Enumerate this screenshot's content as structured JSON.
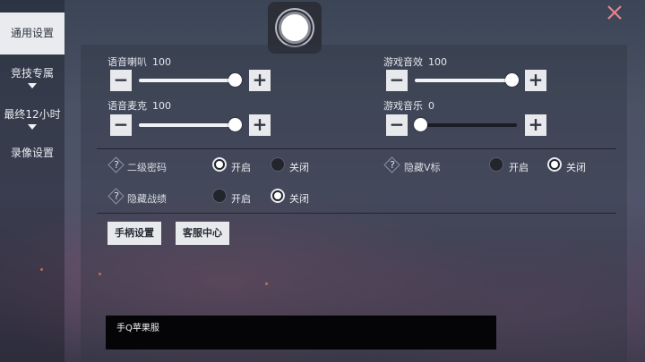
{
  "sidebar": {
    "items": [
      {
        "label": "通用设置",
        "active": true
      },
      {
        "label": "竞技专属",
        "has_caret": true
      },
      {
        "label": "最终12小时",
        "has_caret": true
      },
      {
        "label": "录像设置"
      }
    ]
  },
  "header": {
    "language_icon": "circle-button-icon",
    "close_icon": "close-icon"
  },
  "sliders": [
    {
      "label": "语音喇叭",
      "value": "100",
      "fraction": 1.0
    },
    {
      "label": "语音麦克",
      "value": "100",
      "fraction": 1.0
    },
    {
      "label": "游戏音效",
      "value": "100",
      "fraction": 1.0
    },
    {
      "label": "游戏音乐",
      "value": "0",
      "fraction": 0.0
    }
  ],
  "slider_buttons": {
    "minus": "−",
    "plus": "+"
  },
  "options": {
    "second_password": {
      "label": "二级密码",
      "on_label": "开启",
      "off_label": "关闭",
      "selected": "on"
    },
    "hide_v_badge": {
      "label": "隐藏V标",
      "on_label": "开启",
      "off_label": "关闭",
      "selected": "off"
    },
    "hide_record": {
      "label": "隐藏战绩",
      "on_label": "开启",
      "off_label": "关闭",
      "selected": "off"
    },
    "help_glyph": "?"
  },
  "buttons": {
    "controller": "手柄设置",
    "support": "客服中心"
  },
  "info": {
    "server_text": "手Q苹果服"
  },
  "colors": {
    "panel_button_bg": "#e8e9ed",
    "sidebar_active_bg": "#e9ebef",
    "info_box_bg": "#050507"
  }
}
